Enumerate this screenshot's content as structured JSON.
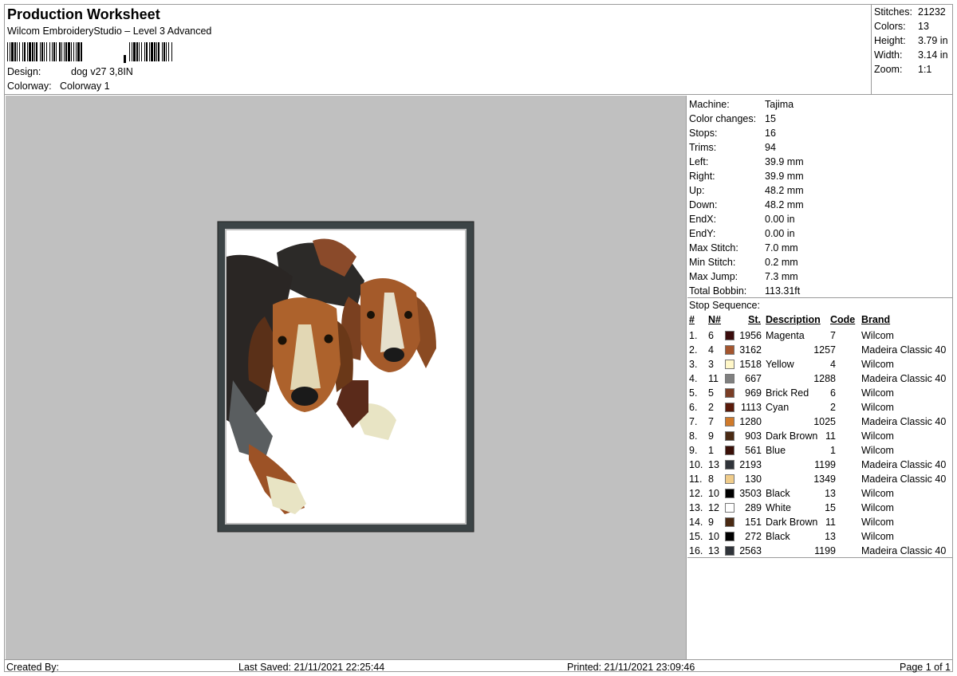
{
  "header": {
    "title": "Production Worksheet",
    "subtitle": "Wilcom EmbroideryStudio – Level 3 Advanced",
    "design_label": "Design:",
    "design_value": "dog v27 3,8IN",
    "colorway_label": "Colorway:",
    "colorway_value": "Colorway 1"
  },
  "summary": [
    {
      "label": "Stitches:",
      "value": "21232"
    },
    {
      "label": "Colors:",
      "value": "13"
    },
    {
      "label": "Height:",
      "value": "3.79 in"
    },
    {
      "label": "Width:",
      "value": "3.14 in"
    },
    {
      "label": "Zoom:",
      "value": "1:1"
    }
  ],
  "machine": [
    {
      "label": "Machine:",
      "value": "Tajima"
    },
    {
      "label": "Color changes:",
      "value": "15"
    },
    {
      "label": "Stops:",
      "value": "16"
    },
    {
      "label": "Trims:",
      "value": "94"
    },
    {
      "label": "Left:",
      "value": "39.9 mm"
    },
    {
      "label": "Right:",
      "value": "39.9 mm"
    },
    {
      "label": "Up:",
      "value": "48.2 mm"
    },
    {
      "label": "Down:",
      "value": "48.2 mm"
    },
    {
      "label": "EndX:",
      "value": "0.00 in"
    },
    {
      "label": "EndY:",
      "value": "0.00 in"
    },
    {
      "label": "Max Stitch:",
      "value": "7.0 mm"
    },
    {
      "label": "Min Stitch:",
      "value": "0.2 mm"
    },
    {
      "label": "Max Jump:",
      "value": "7.3 mm"
    },
    {
      "label": "Total Bobbin:",
      "value": "113.31ft"
    }
  ],
  "stop_sequence": {
    "title": "Stop Sequence:",
    "headers": {
      "idx": "#",
      "n": "N#",
      "st": "St.",
      "desc": "Description",
      "code": "Code",
      "brand": "Brand"
    },
    "rows": [
      {
        "idx": "1.",
        "n": "6",
        "color": "#3a0c0c",
        "st": "1956",
        "desc": "Magenta",
        "code": "7",
        "brand": "Wilcom"
      },
      {
        "idx": "2.",
        "n": "4",
        "color": "#a4552e",
        "st": "3162",
        "desc": "",
        "code": "1257",
        "brand": "Madeira Classic 40"
      },
      {
        "idx": "3.",
        "n": "3",
        "color": "#fff7c8",
        "st": "1518",
        "desc": "Yellow",
        "code": "4",
        "brand": "Wilcom"
      },
      {
        "idx": "4.",
        "n": "11",
        "color": "#808080",
        "st": "667",
        "desc": "",
        "code": "1288",
        "brand": "Madeira Classic 40"
      },
      {
        "idx": "5.",
        "n": "5",
        "color": "#7a3e26",
        "st": "969",
        "desc": "Brick Red",
        "code": "6",
        "brand": "Wilcom"
      },
      {
        "idx": "6.",
        "n": "2",
        "color": "#5a1a0a",
        "st": "1113",
        "desc": "Cyan",
        "code": "2",
        "brand": "Wilcom"
      },
      {
        "idx": "7.",
        "n": "7",
        "color": "#d07a2a",
        "st": "1280",
        "desc": "",
        "code": "1025",
        "brand": "Madeira Classic 40"
      },
      {
        "idx": "8.",
        "n": "9",
        "color": "#4a2a14",
        "st": "903",
        "desc": "Dark Brown",
        "code": "11",
        "brand": "Wilcom"
      },
      {
        "idx": "9.",
        "n": "1",
        "color": "#3a1008",
        "st": "561",
        "desc": "Blue",
        "code": "1",
        "brand": "Wilcom"
      },
      {
        "idx": "10.",
        "n": "13",
        "color": "#30343a",
        "st": "2193",
        "desc": "",
        "code": "1199",
        "brand": "Madeira Classic 40"
      },
      {
        "idx": "11.",
        "n": "8",
        "color": "#f0cc8a",
        "st": "130",
        "desc": "",
        "code": "1349",
        "brand": "Madeira Classic 40"
      },
      {
        "idx": "12.",
        "n": "10",
        "color": "#000000",
        "st": "3503",
        "desc": "Black",
        "code": "13",
        "brand": "Wilcom"
      },
      {
        "idx": "13.",
        "n": "12",
        "color": "#ffffff",
        "st": "289",
        "desc": "White",
        "code": "15",
        "brand": "Wilcom"
      },
      {
        "idx": "14.",
        "n": "9",
        "color": "#4a2a14",
        "st": "151",
        "desc": "Dark Brown",
        "code": "11",
        "brand": "Wilcom"
      },
      {
        "idx": "15.",
        "n": "10",
        "color": "#000000",
        "st": "272",
        "desc": "Black",
        "code": "13",
        "brand": "Wilcom"
      },
      {
        "idx": "16.",
        "n": "13",
        "color": "#30343a",
        "st": "2563",
        "desc": "",
        "code": "1199",
        "brand": "Madeira Classic 40"
      }
    ]
  },
  "footer": {
    "created_by": "Created By:",
    "last_saved": "Last Saved: 21/11/2021 22:25:44",
    "printed": "Printed: 21/11/2021 23:09:46",
    "page": "Page 1 of 1"
  },
  "colors": {
    "preview_bg": "#c0c0c0",
    "frame_stitch": "#3c4446"
  }
}
